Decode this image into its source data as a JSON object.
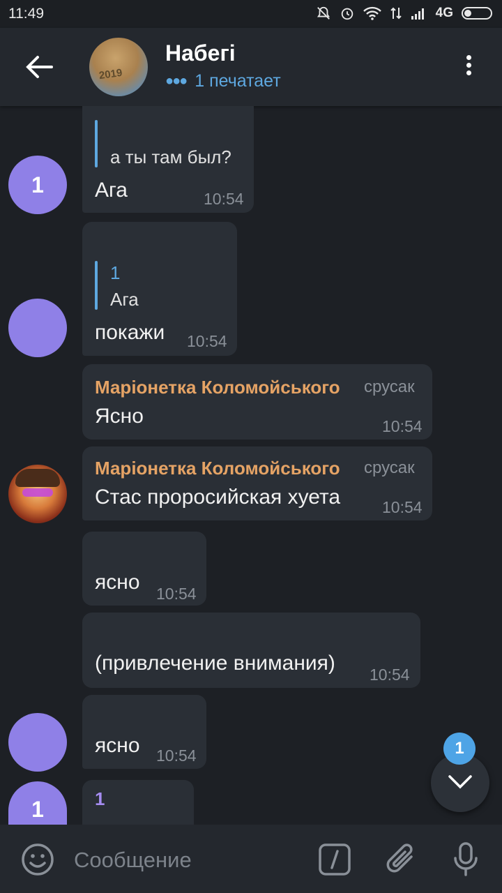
{
  "status_bar": {
    "time": "11:49",
    "network": "4G"
  },
  "header": {
    "title": "Набегі",
    "typing_status": "1 печатает",
    "avatar_text": "2019"
  },
  "messages": [
    {
      "reply_text": "а ты там был?",
      "text": "Ага",
      "time": "10:54",
      "avatar_letter": "1"
    },
    {
      "reply_name": "1",
      "reply_text": "Ага",
      "text": "покажи",
      "time": "10:54"
    },
    {
      "sender": "Маріонетка Коломойського",
      "role": "срусак",
      "text": "Ясно",
      "time": "10:54"
    },
    {
      "sender": "Маріонетка Коломойського",
      "role": "срусак",
      "text": "Стас проросийская хуета",
      "time": "10:54"
    },
    {
      "text": "ясно",
      "time": "10:54"
    },
    {
      "text": "(привлечение внимания)",
      "time": "10:54"
    },
    {
      "text": "ясно",
      "time": "10:54"
    },
    {
      "reply_name": "1",
      "avatar_letter": "1"
    }
  ],
  "scroll_button": {
    "unread_count": "1"
  },
  "input": {
    "placeholder": "Сообщение"
  },
  "colors": {
    "accent": "#5ea8e0",
    "sender": "#e5a365",
    "avatar": "#8f80e7",
    "bubble": "#2a2f36",
    "background": "#1d2025"
  }
}
